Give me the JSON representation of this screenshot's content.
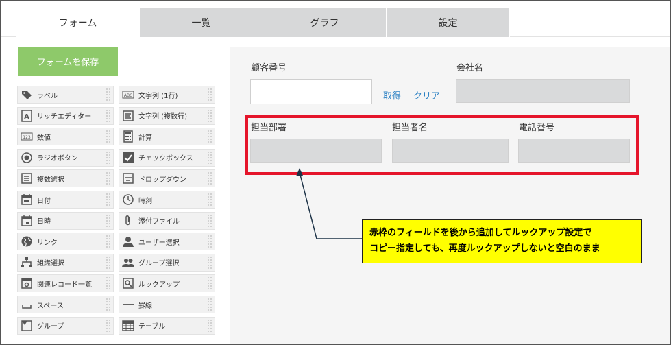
{
  "tabs": [
    {
      "label": "フォーム",
      "active": true
    },
    {
      "label": "一覧",
      "active": false
    },
    {
      "label": "グラフ",
      "active": false
    },
    {
      "label": "設定",
      "active": false
    }
  ],
  "palette": {
    "save_label": "フォームを保存",
    "save_color": "#8ec96a",
    "items": [
      {
        "label": "ラベル",
        "icon": "tag-icon"
      },
      {
        "label": "文字列 (1行)",
        "icon": "text-abc-icon"
      },
      {
        "label": "リッチエディター",
        "icon": "rich-editor-icon"
      },
      {
        "label": "文字列 (複数行)",
        "icon": "multiline-text-icon"
      },
      {
        "label": "数値",
        "icon": "number-123-icon"
      },
      {
        "label": "計算",
        "icon": "calculator-icon"
      },
      {
        "label": "ラジオボタン",
        "icon": "radio-icon"
      },
      {
        "label": "チェックボックス",
        "icon": "checkbox-icon"
      },
      {
        "label": "複数選択",
        "icon": "multi-select-icon"
      },
      {
        "label": "ドロップダウン",
        "icon": "dropdown-icon"
      },
      {
        "label": "日付",
        "icon": "calendar-icon"
      },
      {
        "label": "時刻",
        "icon": "clock-icon"
      },
      {
        "label": "日時",
        "icon": "datetime-icon"
      },
      {
        "label": "添付ファイル",
        "icon": "paperclip-icon"
      },
      {
        "label": "リンク",
        "icon": "globe-icon"
      },
      {
        "label": "ユーザー選択",
        "icon": "user-icon"
      },
      {
        "label": "組織選択",
        "icon": "org-icon"
      },
      {
        "label": "グループ選択",
        "icon": "group-icon"
      },
      {
        "label": "関連レコード一覧",
        "icon": "related-records-icon"
      },
      {
        "label": "ルックアップ",
        "icon": "lookup-icon"
      },
      {
        "label": "スペース",
        "icon": "space-icon"
      },
      {
        "label": "罫線",
        "icon": "line-icon"
      },
      {
        "label": "グループ",
        "icon": "group-folder-icon"
      },
      {
        "label": "テーブル",
        "icon": "table-icon"
      }
    ]
  },
  "form": {
    "customer_no_label": "顧客番号",
    "company_label": "会社名",
    "fetch_link": "取得",
    "clear_link": "クリア",
    "dept_label": "担当部署",
    "person_label": "担当者名",
    "phone_label": "電話番号"
  },
  "annotation": {
    "line1": "赤枠のフィールドを後から追加してルックアップ設定で",
    "line2": "コピー指定しても、再度ルックアップしないと空白のまま",
    "highlight_color": "#e5152b",
    "callout_color": "#ffff00"
  }
}
